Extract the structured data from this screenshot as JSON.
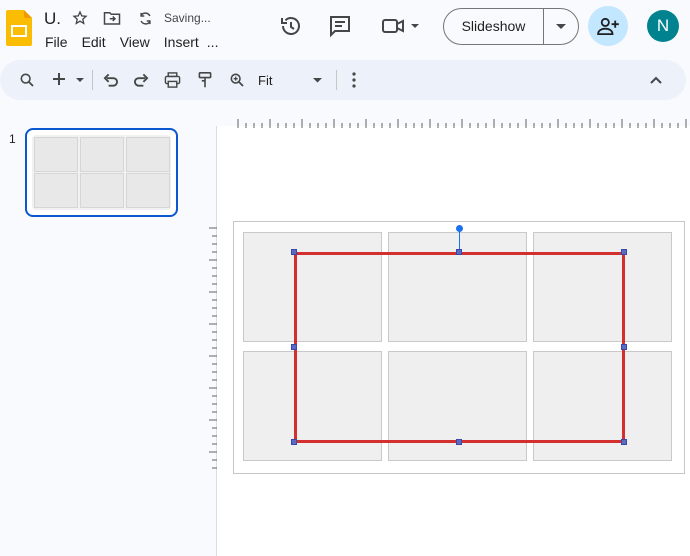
{
  "app": {
    "doc_title": "U.",
    "status": "Saving...",
    "menu": [
      "File",
      "Edit",
      "View",
      "Insert",
      "..."
    ],
    "slideshow_label": "Slideshow",
    "avatar_initial": "N",
    "colors": {
      "accent": "#0b57d0",
      "avatar": "#00838f",
      "share_bg": "#c2e7ff",
      "logo": "#fbbc04",
      "selection": "#d32f2f"
    }
  },
  "toolbar": {
    "zoom_value": "Fit",
    "icons": [
      "search-icon",
      "new-slide-icon",
      "undo-icon",
      "redo-icon",
      "print-icon",
      "paint-format-icon",
      "zoom-icon",
      "more-vert-icon",
      "collapse-icon"
    ]
  },
  "filmstrip": {
    "slides": [
      {
        "number": "1"
      }
    ]
  }
}
